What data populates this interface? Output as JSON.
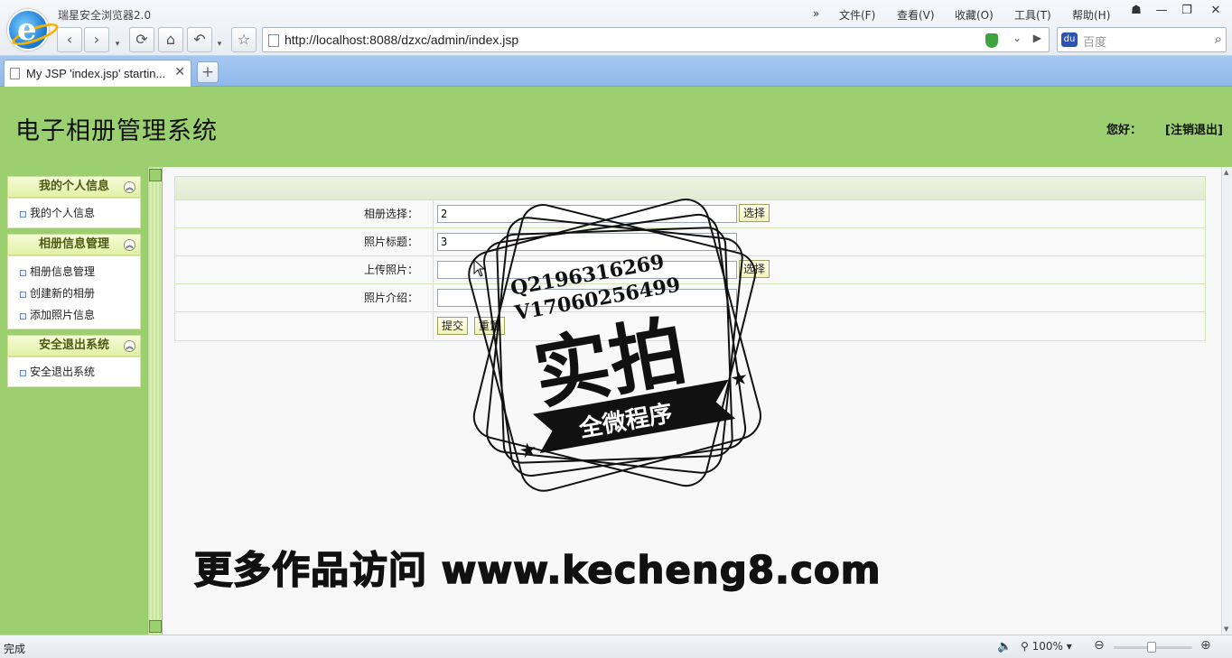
{
  "browser": {
    "app_title": "瑞星安全浏览器2.0",
    "menu": [
      "文件(F)",
      "查看(V)",
      "收藏(O)",
      "工具(T)",
      "帮助(H)"
    ],
    "menu_more": "»",
    "address": "http://localhost:8088/dzxc/admin/index.jsp",
    "search_placeholder": "百度",
    "tab_title": "My JSP 'index.jsp' startin...",
    "tab_close": "✕",
    "new_tab": "+",
    "status_text": "完成",
    "zoom": "100%"
  },
  "header": {
    "site_title": "电子相册管理系统",
    "greeting": "您好：",
    "logout": "[注销退出]"
  },
  "sidebar": [
    {
      "title": "我的个人信息",
      "items": [
        "我的个人信息"
      ]
    },
    {
      "title": "相册信息管理",
      "items": [
        "相册信息管理",
        "创建新的相册",
        "添加照片信息"
      ]
    },
    {
      "title": "安全退出系统",
      "items": [
        "安全退出系统"
      ]
    }
  ],
  "form": {
    "album_label": "相册选择：",
    "album_value": "2",
    "album_select_button": "选择",
    "title_label": "照片标题：",
    "title_value": "3",
    "upload_label": "上传照片：",
    "upload_value": "",
    "upload_select_button": "选择",
    "intro_label": "照片介绍：",
    "intro_value": "",
    "submit_button": "提交",
    "reset_button": "重置"
  },
  "watermark": {
    "qq": "Q2196316269",
    "phone": "V17060256499",
    "main": "实拍",
    "banner": "全微程序",
    "footer": "更多作品访问 www.kecheng8.com"
  },
  "colors": {
    "page_green": "#9ccf6f",
    "sidebar_header": "#e3f0a8",
    "tabbar_blue": "#8fb8ea"
  }
}
